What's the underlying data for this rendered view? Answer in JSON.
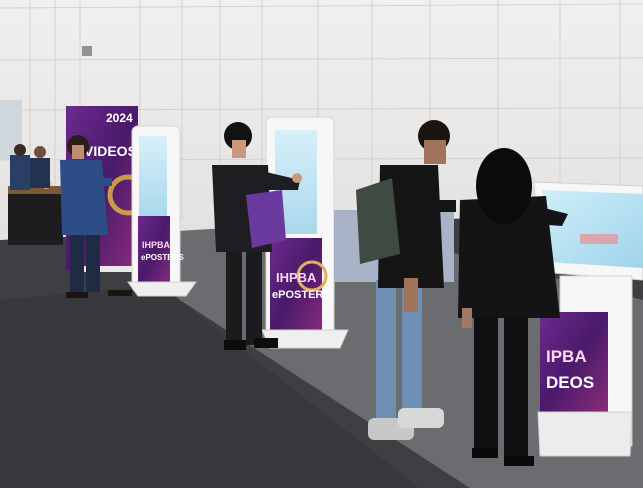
{
  "banner_left": {
    "year": "2024",
    "word": "VIDEOS"
  },
  "kiosk_small": {
    "line1": "IHPBA",
    "line2": "ePOSTERS"
  },
  "kiosk_center": {
    "line1": "IHPBA",
    "line2": "ePOSTERS"
  },
  "kiosk_right": {
    "line1": "IPBA",
    "line2": "DEOS"
  },
  "colors": {
    "wall": "#ecebe9",
    "floor_carpet": "#3e3f42",
    "floor_aisle": "#6b6c70",
    "kiosk_white": "#f7f7f7",
    "sign_purple": "#5a1f7a",
    "screen_blue": "#bfe4f4"
  }
}
